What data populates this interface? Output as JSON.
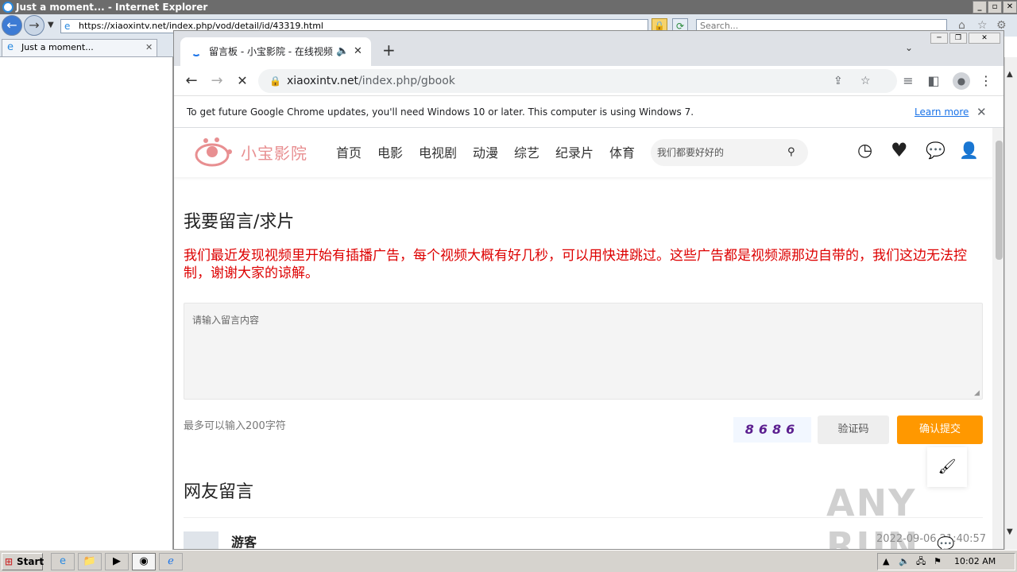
{
  "ie": {
    "title": "Just a moment... - Internet Explorer",
    "address": "https://xiaoxintv.net/index.php/vod/detail/id/43319.html",
    "search_placeholder": "Search...",
    "tab_label": "Just a moment..."
  },
  "chrome": {
    "tab_title": "留言板 - 小宝影院 - 在线视频",
    "omnibox_host": "xiaoxintv.net",
    "omnibox_path": "/index.php/gbook",
    "infobar_text": "To get future Google Chrome updates, you'll need Windows 10 or later. This computer is using Windows 7.",
    "infobar_link": "Learn more"
  },
  "site": {
    "logo_text": "小宝影院",
    "nav": [
      "首页",
      "电影",
      "电视剧",
      "动漫",
      "综艺",
      "纪录片",
      "体育"
    ],
    "search_placeholder": "我们都要好好的",
    "page_title": "我要留言/求片",
    "notice": "我们最近发现视频里开始有插播广告，每个视频大概有好几秒，可以用快进跳过。这些广告都是视频源那边自带的，我们这边无法控制，谢谢大家的谅解。",
    "message_placeholder": "请输入留言内容",
    "char_limit": "最多可以输入200字符",
    "captcha": "8686",
    "verify_label": "验证码",
    "submit_label": "确认提交",
    "comments_title": "网友留言",
    "comment_user": "游客",
    "comment_time": "2022-09-06 21:40:57"
  },
  "watermark": "ANY RUN",
  "taskbar": {
    "start_label": "Start",
    "clock": "10:02 AM"
  },
  "colors": {
    "accent_orange": "#ff9800",
    "notice_red": "#dd0000",
    "logo_pink": "#e88f91",
    "chrome_blue": "#1a73e8"
  }
}
